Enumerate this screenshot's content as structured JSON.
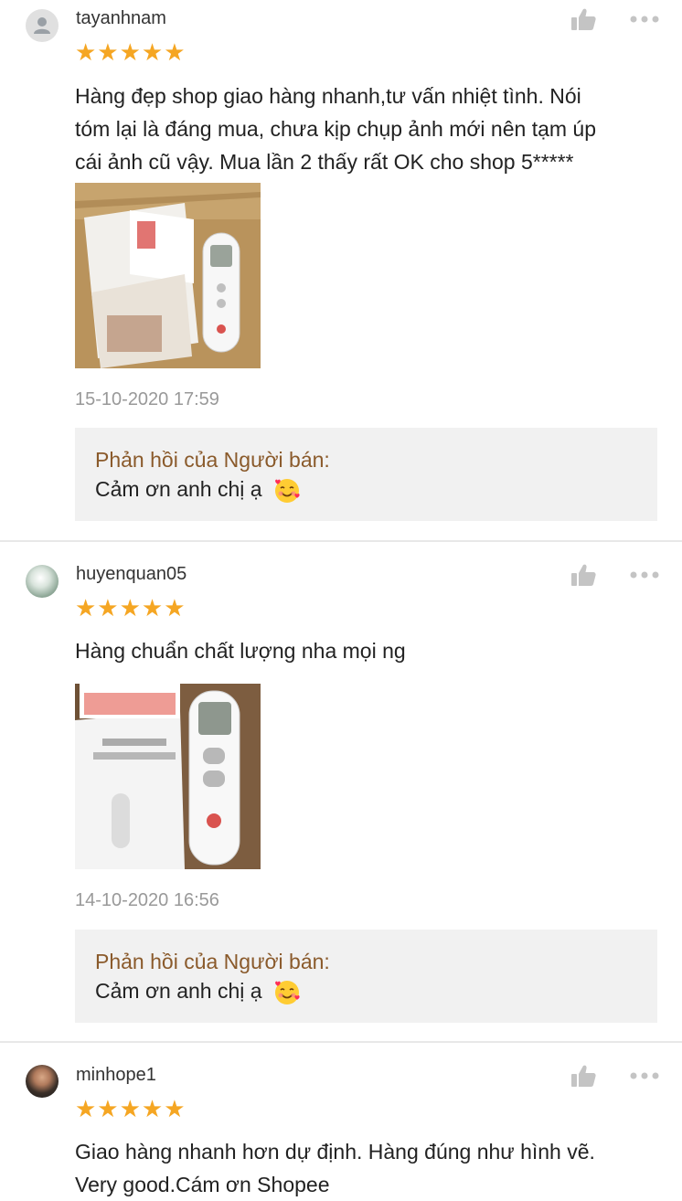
{
  "colors": {
    "star": "#f5a623",
    "reply_title": "#8a5a2b",
    "reply_bg": "#f1f1f1",
    "timestamp": "#999999",
    "icon_gray": "#c4c4c4"
  },
  "icons": {
    "like": "thumbs-up-icon",
    "more": "more-options-icon",
    "default_avatar": "user-icon",
    "reply_emoji": "smiling-face-with-hearts-emoji"
  },
  "reviews": [
    {
      "username": "tayanhnam",
      "stars": "★★★★★",
      "rating": 5,
      "comment_lines": [
        "Hàng đẹp shop giao hàng nhanh,tư vấn nhiệt tình. Nói",
        "tóm lại là đáng mua, chưa kịp chụp ảnh mới nên tạm úp",
        "cái ảnh cũ vậy. Mua lần 2 thấy rất OK cho shop 5*****"
      ],
      "timestamp": "15-10-2020 17:59",
      "reply": {
        "title": "Phản hồi của Người bán:",
        "text": "Cảm ơn anh chị ạ"
      }
    },
    {
      "username": "huyenquan05",
      "stars": "★★★★★",
      "rating": 5,
      "comment_lines": [
        "Hàng chuẩn chất lượng nha mọi ng"
      ],
      "timestamp": "14-10-2020 16:56",
      "reply": {
        "title": "Phản hồi của Người bán:",
        "text": "Cảm ơn anh chị ạ"
      }
    },
    {
      "username": "minhope1",
      "stars": "★★★★★",
      "rating": 5,
      "comment_lines": [
        "Giao hàng nhanh hơn dự định. Hàng đúng như hình vẽ.",
        "Very good.Cám ơn Shopee"
      ]
    }
  ]
}
